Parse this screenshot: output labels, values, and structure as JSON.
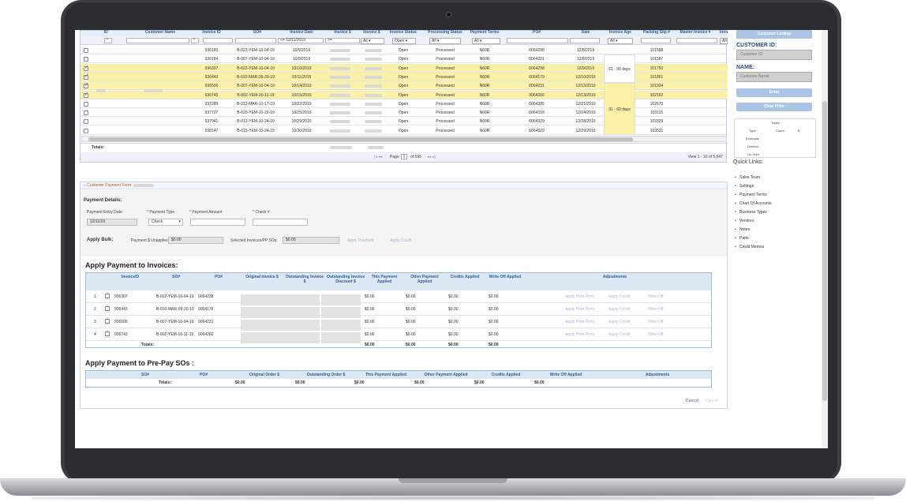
{
  "grid": {
    "headers": [
      "ID",
      "Customer Name",
      "Invoice ID",
      "SO#",
      "Invoice Date",
      "Invoice $",
      "Invoice $",
      "Invoice Status",
      "Processing Status",
      "Payment Terms",
      "PO#",
      "Date",
      "Invoice Age",
      "Packing Slip #",
      "Master Invoice #",
      "Invo"
    ],
    "filters": {
      "date_op": "<=",
      "date_value": "12/11/2019",
      "op1": ">=",
      "op2": ">=",
      "status": "Open",
      "all": "All"
    },
    "rows": [
      {
        "checked": false,
        "invoice_id": "936183",
        "so": "B-022-YEM-10-04-19",
        "date": "10/9/2019",
        "status": "Open",
        "processing": "Processed",
        "terms": "N60R",
        "po": "0064238",
        "date2": "12/8/2019",
        "packing": "101588",
        "hl": false
      },
      {
        "checked": false,
        "invoice_id": "936184",
        "so": "B-007-YEM-10-04-19",
        "date": "10/9/2019",
        "status": "Open",
        "processing": "Processed",
        "terms": "N60R",
        "po": "0064231",
        "date2": "12/8/2019",
        "packing": "101587",
        "hl": false
      },
      {
        "checked": true,
        "invoice_id": "936307",
        "so": "B-022-YEM-10-04-19",
        "date": "10/10/2019",
        "status": "Open",
        "processing": "Processed",
        "terms": "N60R",
        "po": "0064238",
        "date2": "12/9/2019",
        "packing": "101750",
        "hl": true
      },
      {
        "checked": true,
        "invoice_id": "936443",
        "so": "B-010-MAR-09-20-19",
        "date": "10/11/2019",
        "status": "Open",
        "processing": "Processed",
        "terms": "N60R",
        "po": "0064179",
        "date2": "12/10/2019",
        "packing": "101861",
        "hl": true
      },
      {
        "checked": true,
        "invoice_id": "936506",
        "so": "B-007-YEM-10-04-19",
        "date": "10/14/2019",
        "status": "Open",
        "processing": "Processed",
        "terms": "N60R",
        "po": "0064231",
        "date2": "12/13/2019",
        "packing": "101924",
        "hl": true
      },
      {
        "checked": true,
        "invoice_id": "936743",
        "so": "B-002-YEM-10-11-19",
        "date": "10/15/2019",
        "status": "Open",
        "processing": "Processed",
        "terms": "N60R",
        "po": "0064260",
        "date2": "12/13/2019",
        "packing": "102162",
        "hl": true
      },
      {
        "checked": false,
        "invoice_id": "937289",
        "so": "B-013-MAR-10-17-19",
        "date": "10/22/2019",
        "status": "Open",
        "processing": "Processed",
        "terms": "N60R",
        "po": "0064305",
        "date2": "12/21/2019",
        "packing": "102673",
        "hl": false
      },
      {
        "checked": false,
        "invoice_id": "937727",
        "so": "B-020-YEM-10-22-19",
        "date": "10/25/2019",
        "status": "Open",
        "processing": "Processed",
        "terms": "N60R",
        "po": "0064318",
        "date2": "12/24/2019",
        "packing": "103115",
        "hl": false
      },
      {
        "checked": false,
        "invoice_id": "937941",
        "so": "B-013-YEM-10-24-19",
        "date": "10/29/2019",
        "status": "Open",
        "processing": "Processed",
        "terms": "N60R",
        "po": "0064329",
        "date2": "12/28/2019",
        "packing": "103329",
        "hl": false
      },
      {
        "checked": false,
        "invoice_id": "938147",
        "so": "B-015-YEM-10-24-19",
        "date": "10/30/2019",
        "status": "Open",
        "processing": "Processed",
        "terms": "N60R",
        "po": "0064329",
        "date2": "12/29/2019",
        "packing": "103531",
        "hl": false
      }
    ],
    "age_groups": [
      "61 - 90 days",
      "31 - 60 days"
    ],
    "totals_label": "Totals:",
    "pager": {
      "page_label": "Page",
      "page_value": "1",
      "of_label": "of 595",
      "view": "View 1 - 10 of 5,947"
    }
  },
  "payment_form": {
    "title": "Customer Payment Form: ",
    "details_label": "Payment Details:",
    "entry_date_label": "Payment Entry Date:",
    "entry_date": "12/11/19",
    "type_label": "Payment Type",
    "type_value": "Check",
    "amount_label": "Payment Amount",
    "check_label": "Check #",
    "apply_bulk": "Apply Bulk:",
    "unapplied_label": "Payment $ Unapplied",
    "unapplied_value": "$0.00",
    "selected_label": "Selected Invoices/PP SOs:",
    "selected_value": "$0.00",
    "apply_payment": "Apply Payment",
    "apply_credit": "Apply Credit"
  },
  "invoices": {
    "title": "Apply Payment to Invoices:",
    "headers": [
      "InvoiceID",
      "SO#",
      "PO#",
      "Original Invoice $",
      "Outstanding Invoice $",
      "Outstanding Invoice Discount $",
      "This Payment Applied",
      "Other Payment Applied",
      "Credits Applied",
      "Write Off Applied",
      "Adjustments"
    ],
    "rows": [
      {
        "n": "1",
        "id": "936307",
        "so": "B-022-YEM-10-04-19",
        "po": "0064238",
        "this": "$0.00",
        "other": "$0.00",
        "credits": "$0.00",
        "write": "$0.00"
      },
      {
        "n": "2",
        "id": "936443",
        "so": "B-010-MAR-09-20-19",
        "po": "0064179",
        "this": "$0.00",
        "other": "$0.00",
        "credits": "$0.00",
        "write": "$0.00"
      },
      {
        "n": "3",
        "id": "936506",
        "so": "B-007-YEM-10-04-19",
        "po": "0064231",
        "this": "$0.00",
        "other": "$0.00",
        "credits": "$0.00",
        "write": "$0.00"
      },
      {
        "n": "4",
        "id": "936743",
        "so": "B-002-YEM-10-11-19",
        "po": "0064260",
        "this": "$0.00",
        "other": "$0.00",
        "credits": "$0.00",
        "write": "$0.00"
      }
    ],
    "adj_buttons": [
      "Apply Prev Pymt",
      "Apply Credit",
      "Write Off"
    ],
    "totals_label": "Totals:",
    "totals": [
      "$0.00",
      "$0.00",
      "$0.00",
      "$0.00"
    ]
  },
  "prepay": {
    "title": "Apply Payment to Pre-Pay SOs :",
    "headers": [
      "SO#",
      "PO#",
      "Original Order $",
      "Outstanding Order $",
      "This Payment Applied",
      "Other Payment Applied",
      "Credits Applied",
      "Write Off Applied",
      "Adjustments"
    ],
    "totals_label": "Totals:",
    "totals": [
      "$0.00",
      "$0.00",
      "$0.00",
      "$0.00",
      "$0.00",
      "$0.00"
    ]
  },
  "footer": {
    "cancel": "Cancel",
    "cancel2": "Cancel"
  },
  "sidebar": {
    "customer_lookup": "Customer Lookup",
    "customer_id_label": "CUSTOMER ID:",
    "customer_id_placeholder": "Customer ID",
    "name_label": "NAME:",
    "name_placeholder": "Customer Name",
    "enter": "Enter",
    "clear_filter": "Clear Filter",
    "totals_table": {
      "title": "Totals",
      "cols": [
        "Type",
        "Count",
        "$"
      ],
      "rows": [
        "Externals",
        "Deleted",
        "On Hold"
      ]
    },
    "quick_links_title": "Quick Links:",
    "quick_links": [
      "Sales Team",
      "Settings",
      "Payment Terms",
      "Chart Of Accounts",
      "Business Types",
      "Vendors",
      "Notes",
      "Parts",
      "Credit Memos"
    ]
  }
}
